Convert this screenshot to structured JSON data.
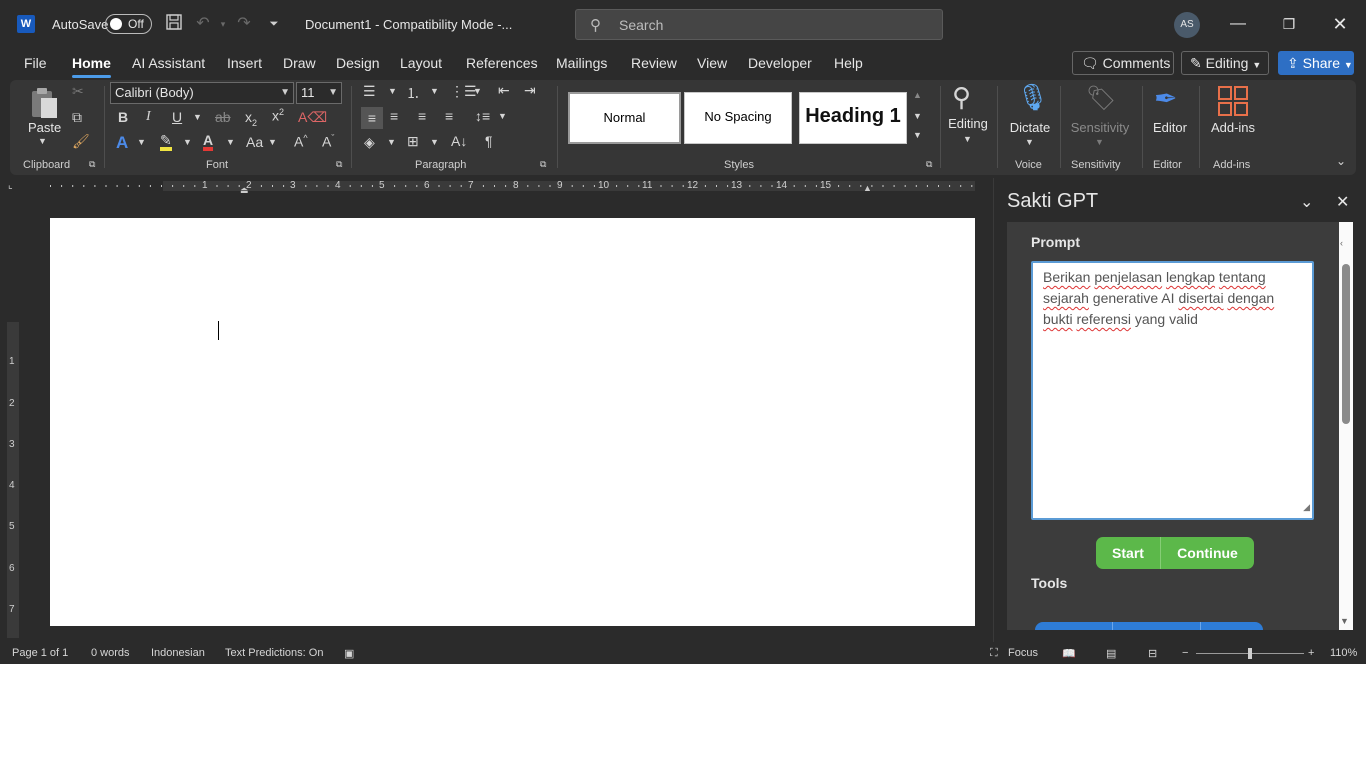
{
  "titlebar": {
    "app_icon": "word-icon",
    "autosave_label": "AutoSave",
    "autosave_state": "Off",
    "document_title": "Document1  -  Compatibility Mode  -...",
    "search_placeholder": "Search",
    "avatar_initials": "AS"
  },
  "menu": {
    "tabs": [
      "File",
      "Home",
      "AI Assistant",
      "Insert",
      "Draw",
      "Design",
      "Layout",
      "References",
      "Mailings",
      "Review",
      "View",
      "Developer",
      "Help"
    ],
    "active_tab": "Home",
    "comments_label": "Comments",
    "editing_label": "Editing",
    "share_label": "Share"
  },
  "ribbon": {
    "paste_label": "Paste",
    "font_name": "Calibri (Body)",
    "font_size": "11",
    "style_normal": "Normal",
    "style_nospacing": "No Spacing",
    "style_heading1": "Heading 1",
    "editing_label": "Editing",
    "dictate_label": "Dictate",
    "sensitivity_label": "Sensitivity",
    "editor_label": "Editor",
    "addins_label": "Add-ins",
    "groups": {
      "clipboard": "Clipboard",
      "font": "Font",
      "paragraph": "Paragraph",
      "styles": "Styles",
      "voice": "Voice",
      "sensitivity": "Sensitivity",
      "editor": "Editor",
      "addins": "Add-ins"
    }
  },
  "ruler": {
    "labels": [
      "1",
      "2",
      "3",
      "4",
      "5",
      "6",
      "7",
      "8",
      "9",
      "10",
      "11",
      "12",
      "13",
      "14",
      "15"
    ],
    "vertical_labels": [
      "1",
      "2",
      "3",
      "4",
      "5",
      "6",
      "7"
    ]
  },
  "pane": {
    "title": "Sakti GPT",
    "prompt_label": "Prompt",
    "prompt_text_parts": [
      "Berikan",
      " ",
      "penjelasan",
      " ",
      "lengkap",
      " ",
      "tentang",
      " ",
      "sejarah",
      " generative AI ",
      "disertai",
      " ",
      "dengan",
      " ",
      "bukti",
      " ",
      "referensi",
      " yang valid"
    ],
    "start_label": "Start",
    "continue_label": "Continue",
    "tools_label": "Tools",
    "accent_green": "#5cb84a",
    "accent_blue": "#2e7cd6"
  },
  "status": {
    "page": "Page 1 of 1",
    "words": "0 words",
    "language": "Indonesian",
    "text_predictions": "Text Predictions: On",
    "focus_label": "Focus",
    "zoom": "110%"
  }
}
